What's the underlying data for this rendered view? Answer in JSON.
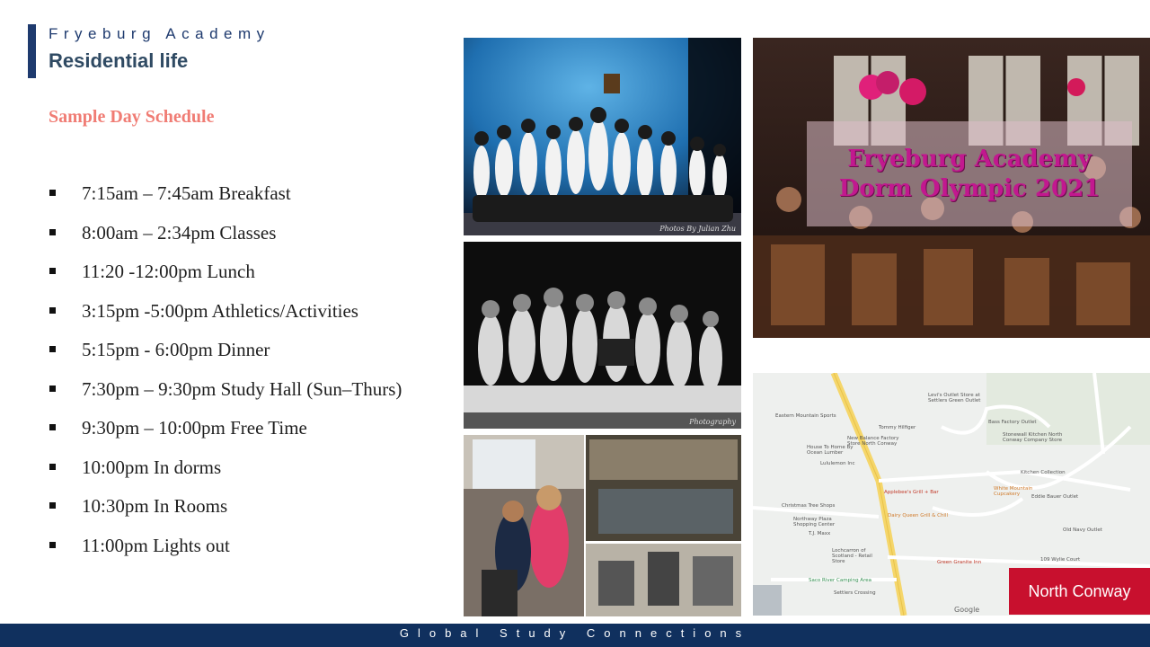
{
  "header": {
    "school": "Fryeburg Academy",
    "title": "Residential life"
  },
  "subtitle": "Sample Day Schedule",
  "schedule": [
    "7:15am – 7:45am Breakfast",
    "8:00am – 2:34pm Classes",
    "11:20 -12:00pm Lunch",
    "3:15pm -5:00pm Athletics/Activities",
    "5:15pm - 6:00pm Dinner",
    "7:30pm – 9:30pm Study Hall (Sun–Thurs)",
    "9:30pm – 10:00pm Free Time",
    "10:00pm In dorms",
    "10:30pm In Rooms",
    "11:00pm Lights out"
  ],
  "photos": {
    "stage_caption": "Photos By Julian Zhu",
    "bw_caption": "Photography"
  },
  "dorm_banner": {
    "line1": "Fryeburg Academy",
    "line2": "Dorm Olympic 2021"
  },
  "map": {
    "labels": {
      "eastern_mountain": "Eastern Mountain Sports",
      "settlers_green": "Levi's Outlet Store at Settlers Green Outlet",
      "tommy": "Tommy Hilfiger",
      "new_balance": "New Balance Factory Store North Conway",
      "bass": "Bass Factory Outlet",
      "stonewall": "Stonewall Kitchen North Conway Company Store",
      "applebees": "Applebee's Grill + Bar",
      "white_mountain": "White Mountain Cupcakery",
      "kitchen": "Kitchen Collection",
      "eddie": "Eddie Bauer Outlet",
      "christmas": "Christmas Tree Shops",
      "northway": "Northway Plaza Shopping Center",
      "tj": "T.J. Maxx",
      "dairy": "Dairy Queen Grill & Chill",
      "old_navy": "Old Navy Outlet",
      "lochcarron": "Lochcarron of Scotland - Retail Store",
      "green_granite": "Green Granite Inn",
      "wylie": "109 Wylie Court",
      "saco": "Saco River Camping Area",
      "settlers_crossing": "Settlers Crossing",
      "lululemon": "Lululemon Inc",
      "house": "House To Home By Ocean Lumber"
    },
    "google": "Google",
    "badge": "North Conway"
  },
  "footer": "Global Study Connections",
  "colors": {
    "navy": "#10305e",
    "coral": "#f07c74",
    "badge_red": "#c8102e",
    "banner_pink": "#c2188f"
  }
}
